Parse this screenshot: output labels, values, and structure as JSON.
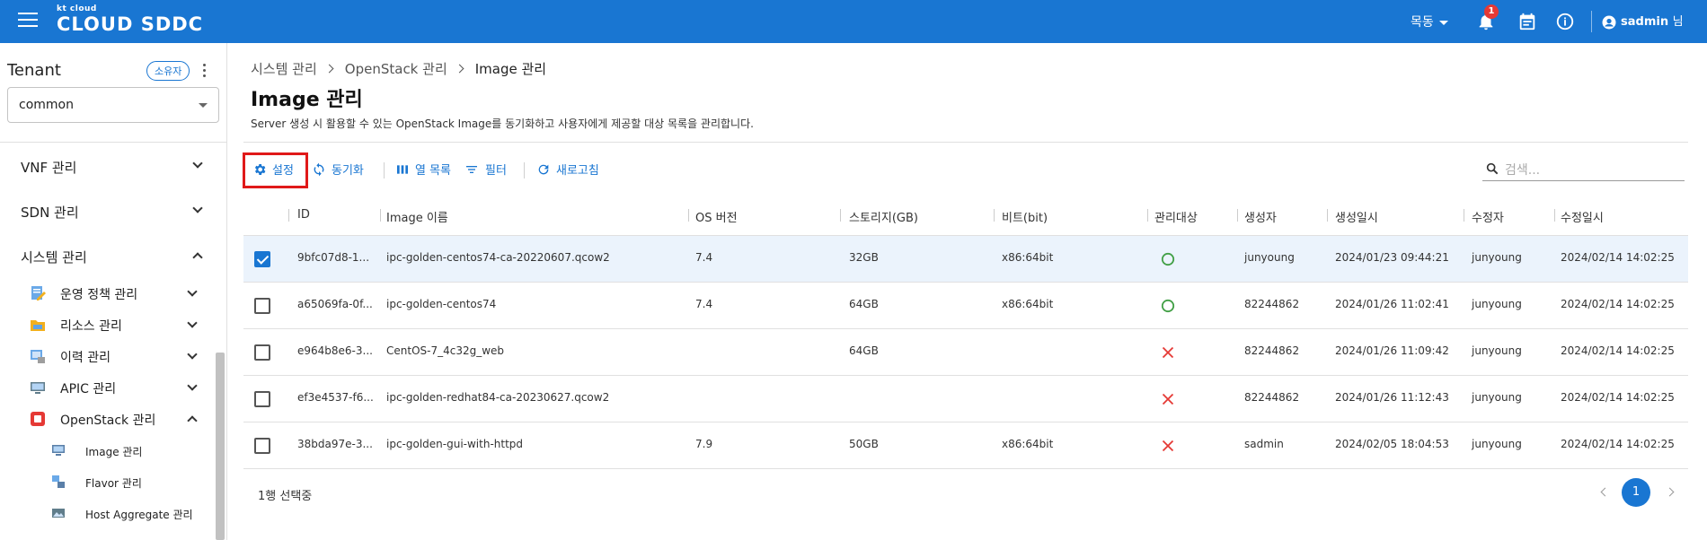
{
  "header": {
    "logo_small": "kt cloud",
    "logo_big": "CLOUD SDDC",
    "region": "목동",
    "notification_count": "1",
    "user_name": "sadmin",
    "user_suffix": "님"
  },
  "sidebar": {
    "tenant_title": "Tenant",
    "owner_chip": "소유자",
    "tenant_value": "common",
    "menus": [
      {
        "label": "VNF 관리",
        "expanded": false
      },
      {
        "label": "SDN 관리",
        "expanded": false
      },
      {
        "label": "시스템 관리",
        "expanded": true
      }
    ],
    "sub_menus": [
      {
        "label": "운영 정책 관리",
        "icon": "policy-icon",
        "expanded": false
      },
      {
        "label": "리소스 관리",
        "icon": "folder-icon",
        "expanded": false
      },
      {
        "label": "이력 관리",
        "icon": "history-icon",
        "expanded": false
      },
      {
        "label": "APIC 관리",
        "icon": "monitor-icon",
        "expanded": false
      },
      {
        "label": "OpenStack 관리",
        "icon": "openstack-icon",
        "expanded": true
      }
    ],
    "leaf_items": [
      {
        "label": "Image 관리",
        "icon": "image-icon"
      },
      {
        "label": "Flavor 관리",
        "icon": "flavor-icon"
      },
      {
        "label": "Host Aggregate 관리",
        "icon": "host-aggregate-icon"
      }
    ]
  },
  "breadcrumb": [
    "시스템 관리",
    "OpenStack 관리",
    "Image 관리"
  ],
  "page": {
    "title": "Image 관리",
    "description": "Server 생성 시 활용할 수 있는 OpenStack Image를 동기화하고 사용자에게 제공할 대상 목록을 관리합니다."
  },
  "toolbar": {
    "settings": "설정",
    "sync": "동기화",
    "columns": "열 목록",
    "filter": "필터",
    "refresh": "새로고침",
    "search_placeholder": "검색..."
  },
  "table": {
    "columns": [
      "ID",
      "Image 이름",
      "OS 버전",
      "스토리지(GB)",
      "비트(bit)",
      "관리대상",
      "생성자",
      "생성일시",
      "수정자",
      "수정일시"
    ],
    "rows": [
      {
        "selected": true,
        "id": "9bfc07d8-1...",
        "name": "ipc-golden-centos74-ca-20220607.qcow2",
        "os": "7.4",
        "storage": "32GB",
        "bit": "x86:64bit",
        "managed": true,
        "creator": "junyoung",
        "created": "2024/01/23 09:44:21",
        "modifier": "junyoung",
        "modified": "2024/02/14 14:02:25"
      },
      {
        "selected": false,
        "id": "a65069fa-0f...",
        "name": "ipc-golden-centos74",
        "os": "7.4",
        "storage": "64GB",
        "bit": "x86:64bit",
        "managed": true,
        "creator": "82244862",
        "created": "2024/01/26 11:02:41",
        "modifier": "junyoung",
        "modified": "2024/02/14 14:02:25"
      },
      {
        "selected": false,
        "id": "e964b8e6-3...",
        "name": "CentOS-7_4c32g_web",
        "os": "",
        "storage": "64GB",
        "bit": "",
        "managed": false,
        "creator": "82244862",
        "created": "2024/01/26 11:09:42",
        "modifier": "junyoung",
        "modified": "2024/02/14 14:02:25"
      },
      {
        "selected": false,
        "id": "ef3e4537-f6...",
        "name": "ipc-golden-redhat84-ca-20230627.qcow2",
        "os": "",
        "storage": "",
        "bit": "",
        "managed": false,
        "creator": "82244862",
        "created": "2024/01/26 11:12:43",
        "modifier": "junyoung",
        "modified": "2024/02/14 14:02:25"
      },
      {
        "selected": false,
        "id": "38bda97e-3...",
        "name": "ipc-golden-gui-with-httpd",
        "os": "7.9",
        "storage": "50GB",
        "bit": "x86:64bit",
        "managed": false,
        "creator": "sadmin",
        "created": "2024/02/05 18:04:53",
        "modifier": "junyoung",
        "modified": "2024/02/14 14:02:25"
      }
    ]
  },
  "footer": {
    "selection_text": "1행 선택중",
    "current_page": "1"
  },
  "colors": {
    "primary": "#1976d2",
    "highlight_box": "#e01919",
    "managed_yes": "#43a047",
    "managed_no": "#e53935",
    "selected_row": "#ebf3fc"
  }
}
